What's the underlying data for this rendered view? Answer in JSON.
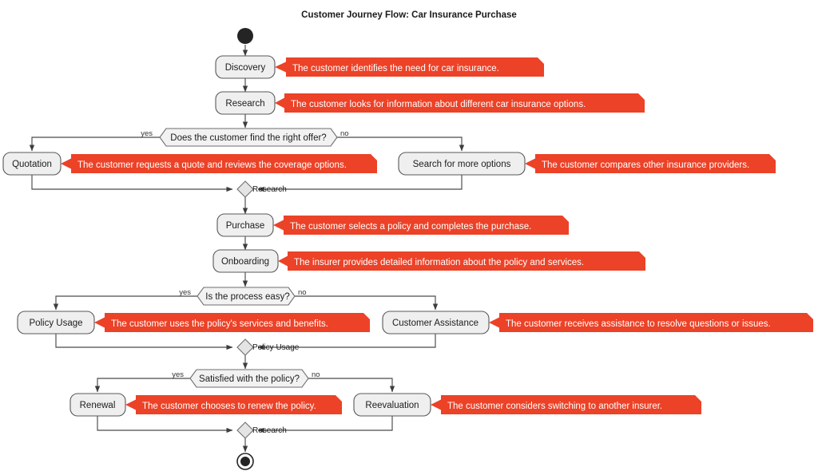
{
  "title": "Customer Journey Flow: Car Insurance Purchase",
  "theme": {
    "note_color": "#ec4227",
    "note_text_color": "#ffffff",
    "node_fill": "#efefef",
    "node_stroke": "#585858",
    "edge_color": "#4a4a4a",
    "start_end_color": "#242424",
    "background": "#ffffff"
  },
  "chart_data": {
    "type": "diagram",
    "diagram_kind": "activity-flowchart",
    "title": "Customer Journey Flow: Car Insurance Purchase",
    "nodes": [
      {
        "id": "start",
        "kind": "start",
        "label": ""
      },
      {
        "id": "discovery",
        "kind": "activity",
        "label": "Discovery"
      },
      {
        "id": "research",
        "kind": "activity",
        "label": "Research"
      },
      {
        "id": "d1",
        "kind": "decision",
        "label": "Does the customer find the right offer?"
      },
      {
        "id": "quotation",
        "kind": "activity",
        "label": "Quotation"
      },
      {
        "id": "search",
        "kind": "activity",
        "label": "Search for more options"
      },
      {
        "id": "m1",
        "kind": "merge",
        "label": "Research"
      },
      {
        "id": "purchase",
        "kind": "activity",
        "label": "Purchase"
      },
      {
        "id": "onboarding",
        "kind": "activity",
        "label": "Onboarding"
      },
      {
        "id": "d2",
        "kind": "decision",
        "label": "Is the process easy?"
      },
      {
        "id": "policyusage",
        "kind": "activity",
        "label": "Policy Usage"
      },
      {
        "id": "assistance",
        "kind": "activity",
        "label": "Customer Assistance"
      },
      {
        "id": "m2",
        "kind": "merge",
        "label": "Policy Usage"
      },
      {
        "id": "d3",
        "kind": "decision",
        "label": "Satisfied with the policy?"
      },
      {
        "id": "renewal",
        "kind": "activity",
        "label": "Renewal"
      },
      {
        "id": "reevaluation",
        "kind": "activity",
        "label": "Reevaluation"
      },
      {
        "id": "m3",
        "kind": "merge",
        "label": "Research"
      },
      {
        "id": "end",
        "kind": "end",
        "label": ""
      }
    ],
    "branch_labels": {
      "d1_yes": "yes",
      "d1_no": "no",
      "d2_yes": "yes",
      "d2_no": "no",
      "d3_yes": "yes",
      "d3_no": "no"
    },
    "notes": [
      {
        "for": "discovery",
        "text": "The customer identifies the need for car insurance."
      },
      {
        "for": "research",
        "text": "The customer looks for information about different car insurance options."
      },
      {
        "for": "quotation",
        "text": "The customer requests a quote and reviews the coverage options."
      },
      {
        "for": "search",
        "text": "The customer compares other insurance providers."
      },
      {
        "for": "purchase",
        "text": "The customer selects a policy and completes the purchase."
      },
      {
        "for": "onboarding",
        "text": "The insurer provides detailed information about the policy and services."
      },
      {
        "for": "policyusage",
        "text": "The customer uses the policy's services and benefits."
      },
      {
        "for": "assistance",
        "text": "The customer receives assistance to resolve questions or issues."
      },
      {
        "for": "renewal",
        "text": "The customer chooses to renew the policy."
      },
      {
        "for": "reevaluation",
        "text": "The customer considers switching to another insurer."
      }
    ],
    "edges": [
      {
        "from": "start",
        "to": "discovery"
      },
      {
        "from": "discovery",
        "to": "research"
      },
      {
        "from": "research",
        "to": "d1"
      },
      {
        "from": "d1",
        "to": "quotation",
        "label": "yes"
      },
      {
        "from": "d1",
        "to": "search",
        "label": "no"
      },
      {
        "from": "quotation",
        "to": "m1"
      },
      {
        "from": "search",
        "to": "m1"
      },
      {
        "from": "m1",
        "to": "purchase"
      },
      {
        "from": "purchase",
        "to": "onboarding"
      },
      {
        "from": "onboarding",
        "to": "d2"
      },
      {
        "from": "d2",
        "to": "policyusage",
        "label": "yes"
      },
      {
        "from": "d2",
        "to": "assistance",
        "label": "no"
      },
      {
        "from": "policyusage",
        "to": "m2"
      },
      {
        "from": "assistance",
        "to": "m2"
      },
      {
        "from": "m2",
        "to": "d3"
      },
      {
        "from": "d3",
        "to": "renewal",
        "label": "yes"
      },
      {
        "from": "d3",
        "to": "reevaluation",
        "label": "no"
      },
      {
        "from": "renewal",
        "to": "m3"
      },
      {
        "from": "reevaluation",
        "to": "m3"
      },
      {
        "from": "m3",
        "to": "end"
      }
    ]
  },
  "nodes": {
    "discovery": "Discovery",
    "research": "Research",
    "quotation": "Quotation",
    "search": "Search for more options",
    "purchase": "Purchase",
    "onboarding": "Onboarding",
    "policyusage": "Policy Usage",
    "assistance": "Customer Assistance",
    "renewal": "Renewal",
    "reevaluation": "Reevaluation"
  },
  "decisions": {
    "d1": "Does the customer find the right offer?",
    "d2": "Is the process easy?",
    "d3": "Satisfied with the policy?"
  },
  "merges": {
    "m1": "Research",
    "m2": "Policy Usage",
    "m3": "Research"
  },
  "branches": {
    "d1_yes": "yes",
    "d1_no": "no",
    "d2_yes": "yes",
    "d2_no": "no",
    "d3_yes": "yes",
    "d3_no": "no"
  },
  "notes": {
    "discovery": "The customer identifies the need for car insurance.",
    "research": "The customer looks for information about different car insurance options.",
    "quotation": "The customer requests a quote and reviews the coverage options.",
    "search": "The customer compares other insurance providers.",
    "purchase": "The customer selects a policy and completes the purchase.",
    "onboarding": "The insurer provides detailed information about the policy and services.",
    "policyusage": "The customer uses the policy's services and benefits.",
    "assistance": "The customer receives assistance to resolve questions or issues.",
    "renewal": "The customer chooses to renew the policy.",
    "reevaluation": "The customer considers switching to another insurer."
  }
}
